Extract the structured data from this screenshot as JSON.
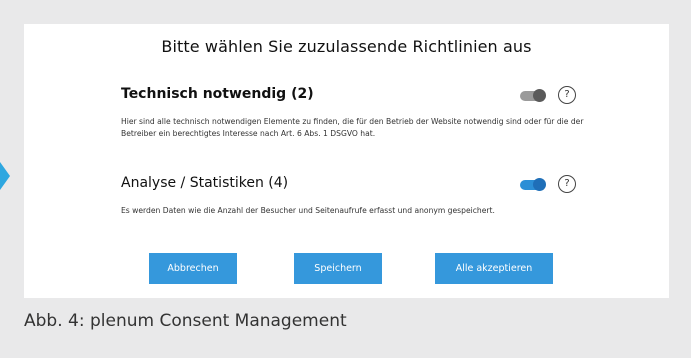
{
  "dialog": {
    "title": "Bitte wählen Sie zuzulassende Richtlinien aus",
    "sections": [
      {
        "title": "Technisch notwendig (2)",
        "toggle_state": "on-disabled",
        "help_label": "?",
        "description": "Hier sind alle technisch notwendigen Elemente zu finden, die für den Betrieb der Website notwendig sind oder für die der Betreiber ein berechtigtes Interesse nach Art. 6 Abs. 1 DSGVO hat."
      },
      {
        "title": "Analyse / Statistiken (4)",
        "toggle_state": "on",
        "help_label": "?",
        "description": "Es werden Daten wie die Anzahl der Besucher und Seitenaufrufe erfasst und anonym gespeichert."
      }
    ],
    "buttons": {
      "cancel": "Abbrechen",
      "save": "Speichern",
      "accept_all": "Alle akzeptieren"
    }
  },
  "caption": "Abb. 4: plenum Consent Management",
  "colors": {
    "background": "#e9e9ea",
    "panel": "#ffffff",
    "button": "#3598dc",
    "toggle_on": "#2c8fd6",
    "toggle_disabled": "#9a9a9a",
    "side_arrow": "#2ea7e0"
  },
  "icons": {
    "help": "question-circle-icon",
    "side_arrow": "caret-right-icon"
  }
}
